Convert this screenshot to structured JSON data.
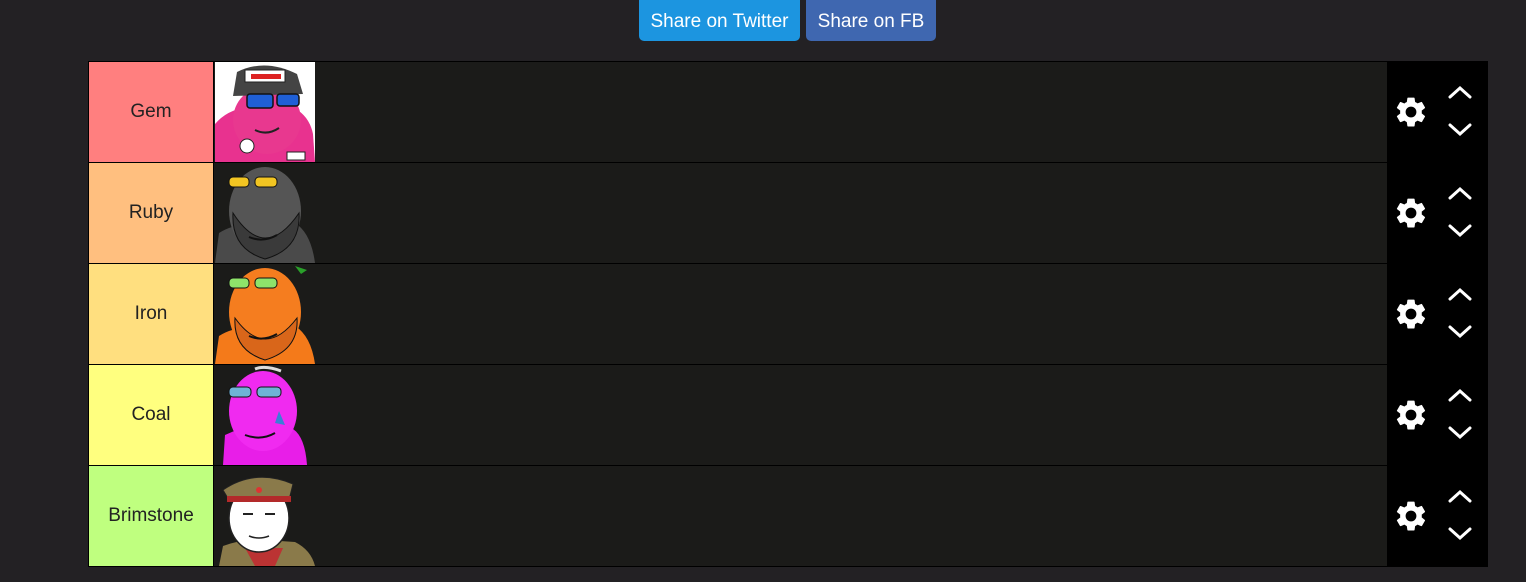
{
  "share": {
    "twitter_label": "Share on Twitter",
    "fb_label": "Share on FB"
  },
  "tiers": [
    {
      "label": "Gem",
      "color": "#ff7f7f",
      "item": "pink-wojak-cap-image"
    },
    {
      "label": "Ruby",
      "color": "#ffbf7f",
      "item": "gray-bearded-wojak-image"
    },
    {
      "label": "Iron",
      "color": "#ffdf7f",
      "item": "orange-bearded-wojak-image"
    },
    {
      "label": "Coal",
      "color": "#ffff7f",
      "item": "magenta-wojak-image"
    },
    {
      "label": "Brimstone",
      "color": "#bfff7f",
      "item": "soldier-wojak-image"
    }
  ],
  "icons": {
    "settings": "gear-icon",
    "move_up": "chevron-up-icon",
    "move_down": "chevron-down-icon"
  }
}
